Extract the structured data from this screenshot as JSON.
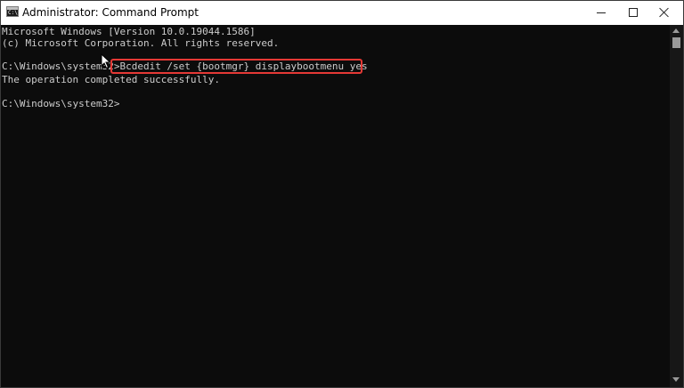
{
  "window": {
    "title": "Administrator: Command Prompt",
    "app_icon_text": "C:\\"
  },
  "console": {
    "lines": [
      "Microsoft Windows [Version 10.0.19044.1586]",
      "(c) Microsoft Corporation. All rights reserved.",
      "The operation completed successfully."
    ],
    "prompt": "C:\\Windows\\system32>",
    "command": "Bcdedit /set {bootmgr} displaybootmenu yes"
  },
  "colors": {
    "console_background": "#0c0c0c",
    "console_text": "#cccccc",
    "highlight_border": "#e53935"
  }
}
